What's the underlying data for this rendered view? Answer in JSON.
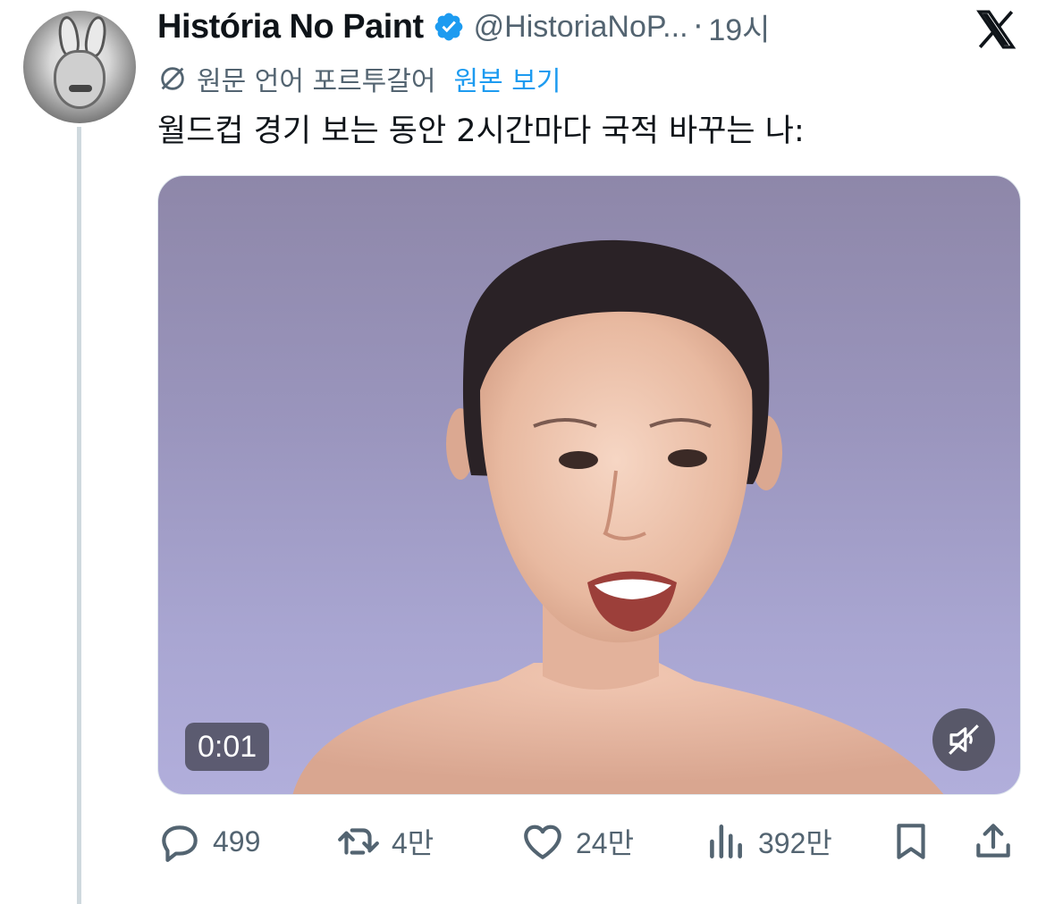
{
  "author": {
    "name": "História No Paint",
    "handle": "@HistoriaNoP...",
    "time": "19시",
    "verified": true
  },
  "translation": {
    "source_label": "원문 언어 포르투갈어",
    "view_original": "원본 보기"
  },
  "tweet": {
    "text": "월드컵 경기 보는 동안 2시간마다 국적 바꾸는 나:"
  },
  "media": {
    "timecode": "0:01",
    "muted": true
  },
  "actions": {
    "replies": "499",
    "retweets": "4만",
    "likes": "24만",
    "views": "392만"
  },
  "colors": {
    "link": "#1d9bf0",
    "muted_text": "#536471",
    "text": "#0f1419",
    "verified": "#1d9bf0"
  },
  "icons": [
    "x-logo-icon",
    "verified-badge-icon",
    "translate-globe-icon",
    "mute-icon",
    "reply-icon",
    "retweet-icon",
    "like-icon",
    "views-icon",
    "bookmark-icon",
    "share-icon"
  ]
}
